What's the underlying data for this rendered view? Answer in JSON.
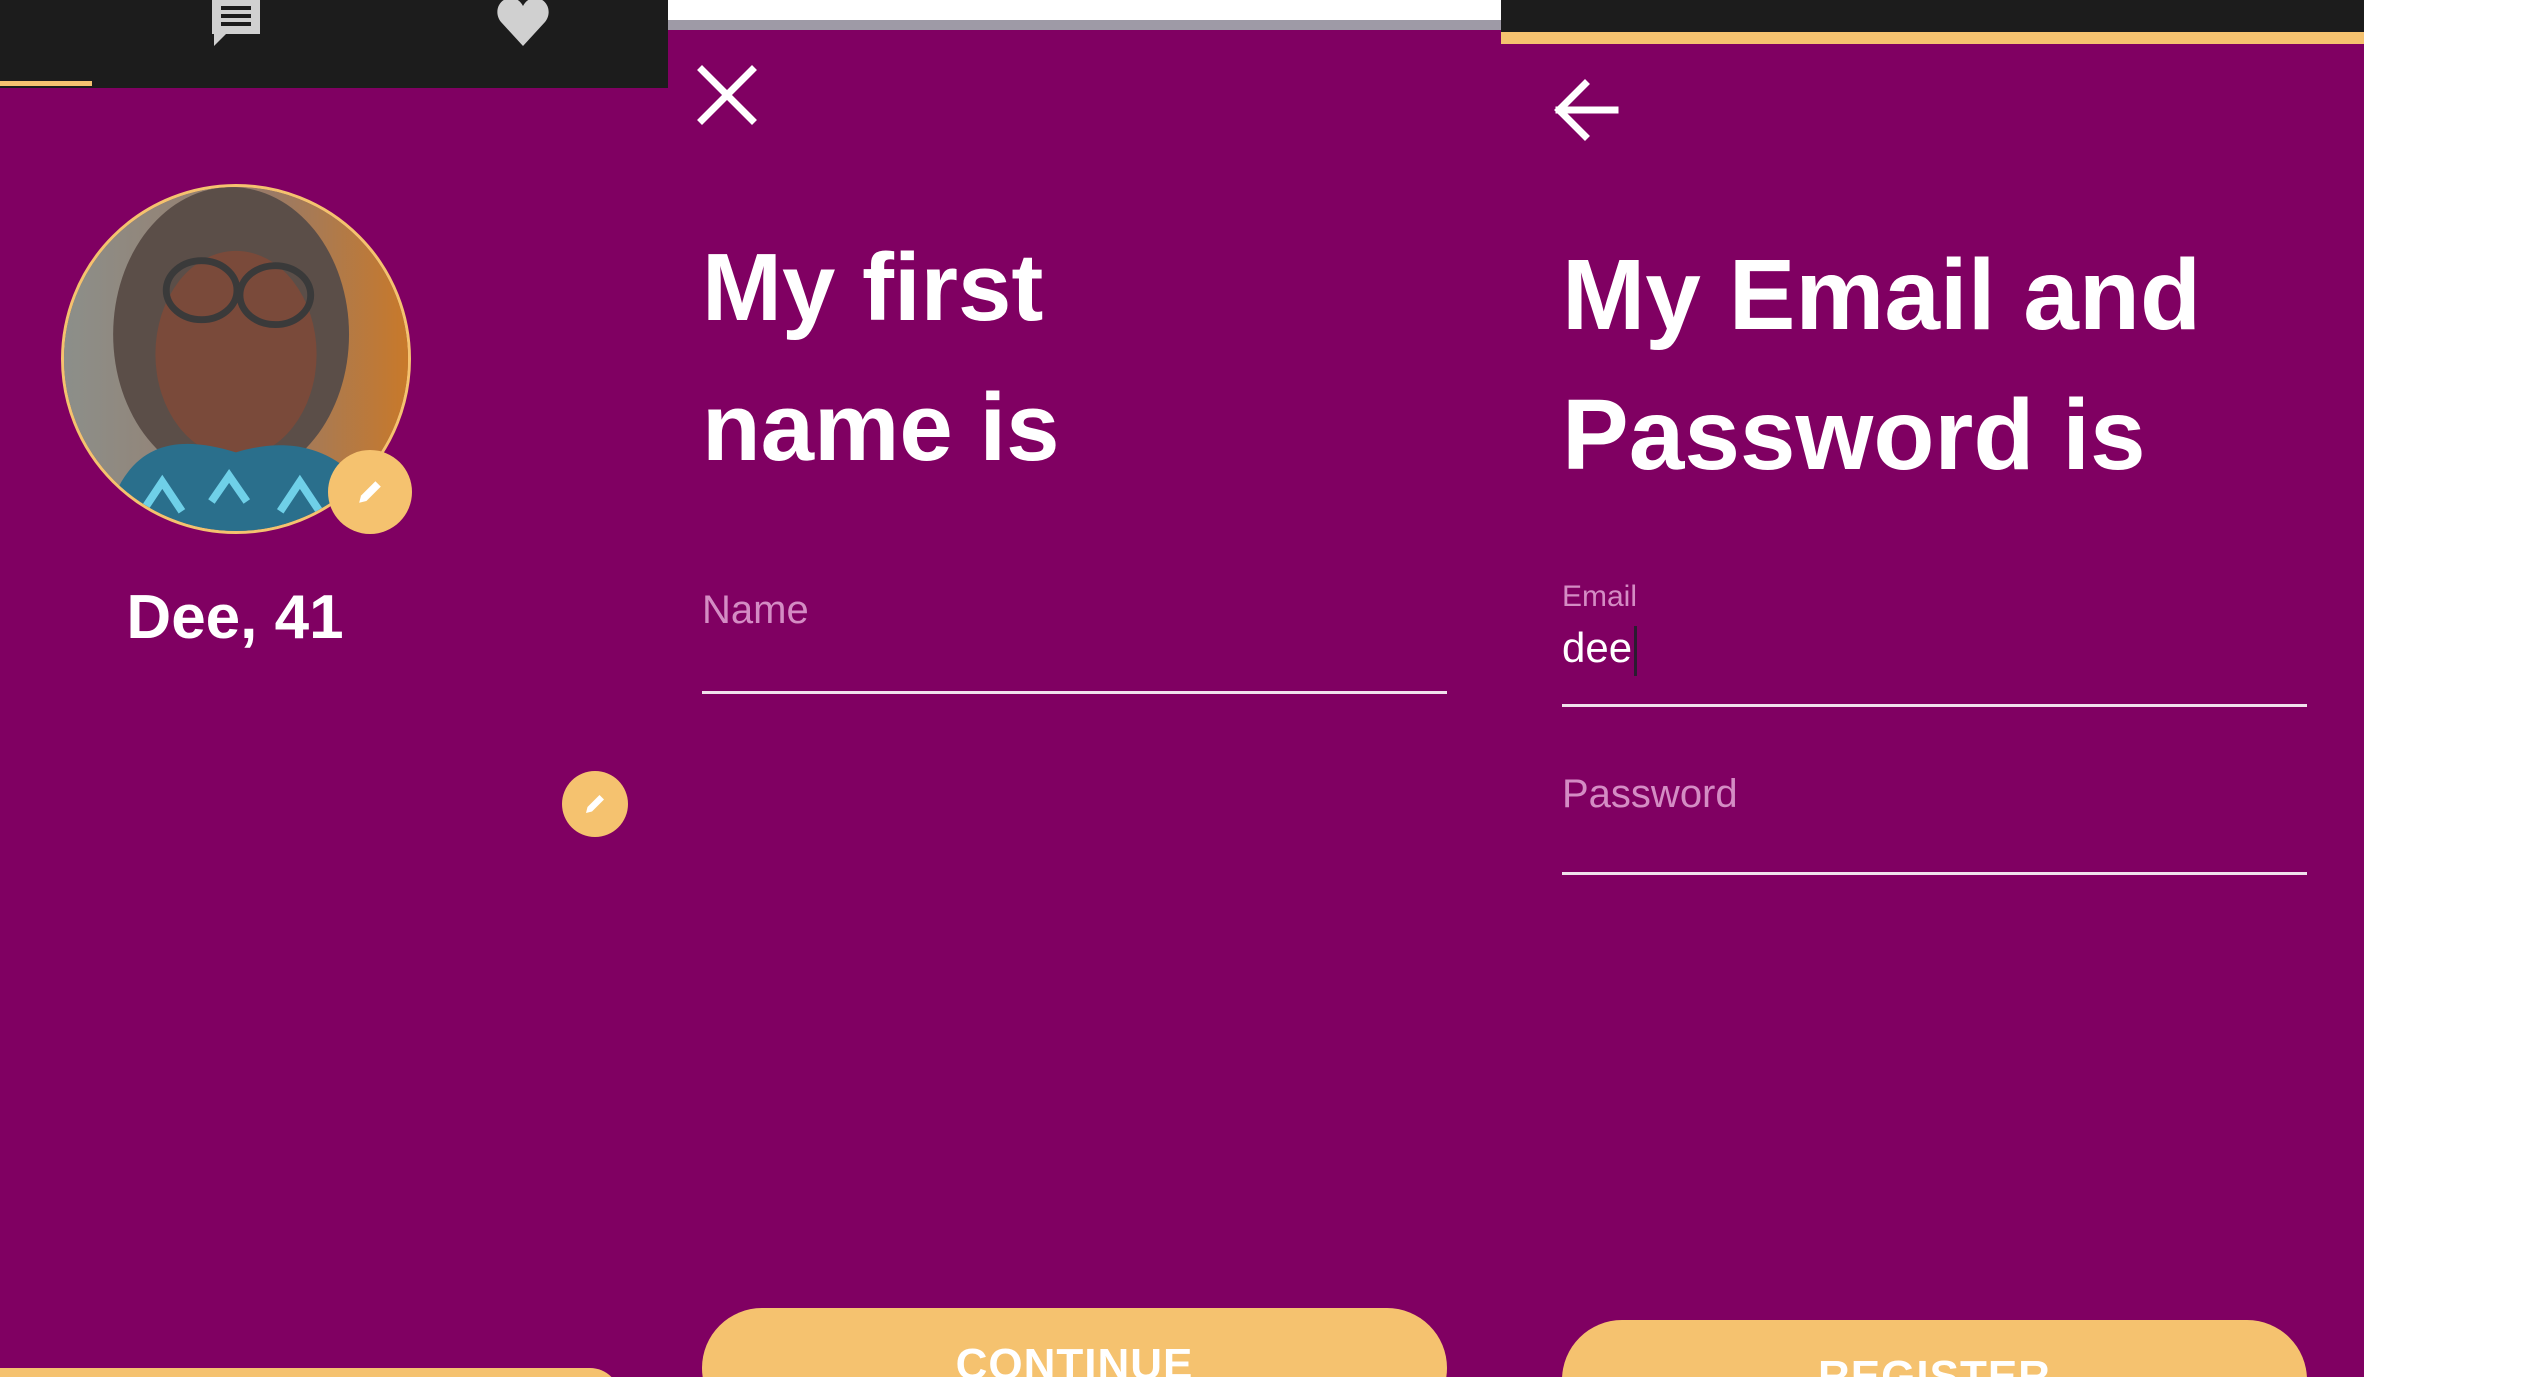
{
  "colors": {
    "background": "#800062",
    "accent": "#f5c26f",
    "tabbar": "#1c1c1c",
    "text": "#ffffff",
    "placeholder": "#d48cc4"
  },
  "profile": {
    "tabs": [
      {
        "icon": "chat-icon"
      },
      {
        "icon": "heart-icon"
      }
    ],
    "avatar_icon": "avatar",
    "edit_icon": "pencil-icon",
    "name_age": "Dee, 41"
  },
  "name_step": {
    "close_icon": "close-icon",
    "heading_line1": "My first",
    "heading_line2": "name is",
    "name_placeholder": "Name",
    "name_value": "",
    "continue_label": "CONTINUE"
  },
  "email_step": {
    "back_icon": "arrow-left-icon",
    "heading_line1": "My Email and",
    "heading_line2": "Password is",
    "email_label": "Email",
    "email_value": "dee",
    "password_placeholder": "Password",
    "password_value": "",
    "register_label": "REGISTER"
  }
}
